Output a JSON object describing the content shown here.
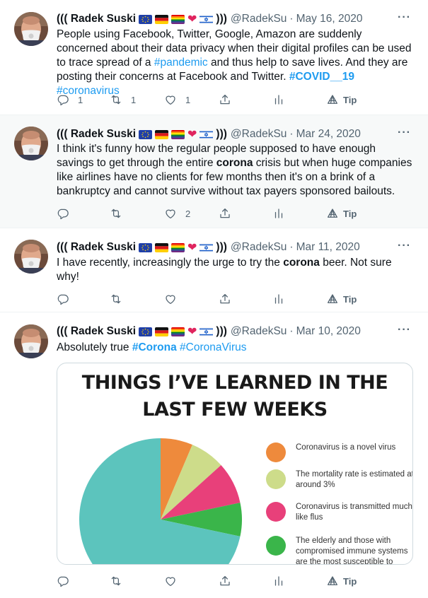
{
  "author": {
    "name_prefix": "(((",
    "name": "Radek Suski",
    "name_suffix": ")))",
    "handle": "@RadekSu",
    "separator": "·"
  },
  "tweets": [
    {
      "date": "May 16, 2020",
      "text": [
        {
          "t": "People using Facebook, Twitter, Google, Amazon are suddenly concerned about their data privacy when their digital profiles can be used to trace spread of a "
        },
        {
          "t": "#pandemic",
          "tag": true
        },
        {
          "t": " and thus help to save lives. And they are posting their concerns at Facebook and Twitter. "
        },
        {
          "t": "#COVID__19",
          "tag": true,
          "bold": true
        },
        {
          "t": " "
        },
        {
          "t": "#coronavirus",
          "tag": true
        }
      ],
      "replies": "1",
      "retweets": "1",
      "likes": "1"
    },
    {
      "date": "Mar 24, 2020",
      "text": [
        {
          "t": "I think it's funny how the regular people supposed to have enough savings to get through the entire "
        },
        {
          "t": "corona",
          "bold": true
        },
        {
          "t": " crisis but when huge companies like airlines have no clients for few months then it's on a brink of a bankruptcy and cannot survive without tax payers sponsored bailouts."
        }
      ],
      "replies": "",
      "retweets": "",
      "likes": "2"
    },
    {
      "date": "Mar 11, 2020",
      "text": [
        {
          "t": "I have recently, increasingly the urge to try the "
        },
        {
          "t": "corona",
          "bold": true
        },
        {
          "t": " beer. Not sure why!"
        }
      ],
      "replies": "",
      "retweets": "",
      "likes": ""
    },
    {
      "date": "Mar 10, 2020",
      "text": [
        {
          "t": "Absolutely true "
        },
        {
          "t": "#Corona",
          "tag": true,
          "bold": true
        },
        {
          "t": " "
        },
        {
          "t": "#CoronaVirus",
          "tag": true
        }
      ],
      "replies": "",
      "retweets": "",
      "likes": ""
    }
  ],
  "actions": {
    "more": "···",
    "tip_label": "Tip"
  },
  "media": {
    "title_line1": "THINGS I’VE LEARNED IN THE",
    "title_line2": "LAST FEW WEEKS",
    "legend": [
      {
        "text": "Coronavirus is a novel virus",
        "color": "#ee8a3c"
      },
      {
        "text": "The mortality rate is estimated at around 3%",
        "color": "#cddc8a"
      },
      {
        "text": "Coronavirus is transmitted much like flus",
        "color": "#e8407a"
      },
      {
        "text": "The elderly and those with compromised immune systems are the most susceptible to",
        "color": "#3ab54a"
      }
    ],
    "pie_main_color": "#5cc4bd"
  },
  "colors": {
    "link": "#1d9bf0",
    "muted": "#536471",
    "heart": "#e0245e"
  }
}
